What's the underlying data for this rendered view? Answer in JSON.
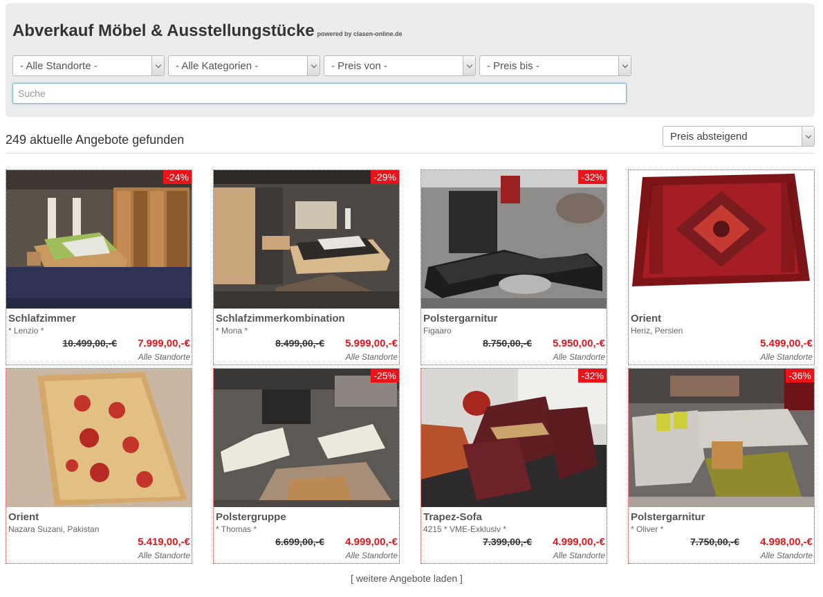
{
  "header": {
    "title": "Abverkauf Möbel & Ausstellungstücke",
    "powered_by": "powered by clasen-online.de"
  },
  "filters": {
    "location": "- Alle Standorte -",
    "category": "- Alle Kategorien -",
    "price_from": "- Preis von -",
    "price_to": "- Preis bis -",
    "search_placeholder": "Suche"
  },
  "results": {
    "count_text": "249 aktuelle Angebote gefunden",
    "sort_selected": "Preis absteigend"
  },
  "colors": {
    "accent_red": "#e8141a",
    "panel_bg": "#ececec"
  },
  "products": [
    {
      "badge": "-24%",
      "name": "Schlafzimmer",
      "sub": "* Lenzio *",
      "old_price": "10.499,00,-€",
      "new_price": "7.999,00,-€",
      "location": "Alle Standorte",
      "scene": "bedroom-bright"
    },
    {
      "badge": "-29%",
      "name": "Schlafzimmerkombination",
      "sub": "* Mona *",
      "old_price": "8.499,00,-€",
      "new_price": "5.999,00,-€",
      "location": "Alle Standorte",
      "scene": "bedroom-dark"
    },
    {
      "badge": "-32%",
      "name": "Polstergarnitur",
      "sub": "Figaaro",
      "old_price": "8.750,00,-€",
      "new_price": "5.950,00,-€",
      "location": "Alle Standorte",
      "scene": "sofa-black"
    },
    {
      "badge": "",
      "name": "Orient",
      "sub": "Heriz, Persien",
      "old_price": "",
      "new_price": "5.499,00,-€",
      "location": "Alle Standorte",
      "scene": "rug-red"
    },
    {
      "badge": "",
      "name": "Orient",
      "sub": "Nazara Suzani, Pakistan",
      "old_price": "",
      "new_price": "5.419,00,-€",
      "location": "Alle Standorte",
      "scene": "rug-suzani"
    },
    {
      "badge": "-25%",
      "name": "Polstergruppe",
      "sub": "* Thomas *",
      "old_price": "6.699,00,-€",
      "new_price": "4.999,00,-€",
      "location": "Alle Standorte",
      "scene": "sofa-cream"
    },
    {
      "badge": "-32%",
      "name": "Trapez-Sofa",
      "sub": "4215 * VME-Exklusiv *",
      "old_price": "7.399,00,-€",
      "new_price": "4.999,00,-€",
      "location": "Alle Standorte",
      "scene": "recliner"
    },
    {
      "badge": "-36%",
      "name": "Polstergarnitur",
      "sub": "* Oliver *",
      "old_price": "7.750,00,-€",
      "new_price": "4.998,00,-€",
      "location": "Alle Standorte",
      "scene": "sofa-grey"
    }
  ],
  "footer": {
    "load_more": "[ weitere Angebote laden ]"
  }
}
